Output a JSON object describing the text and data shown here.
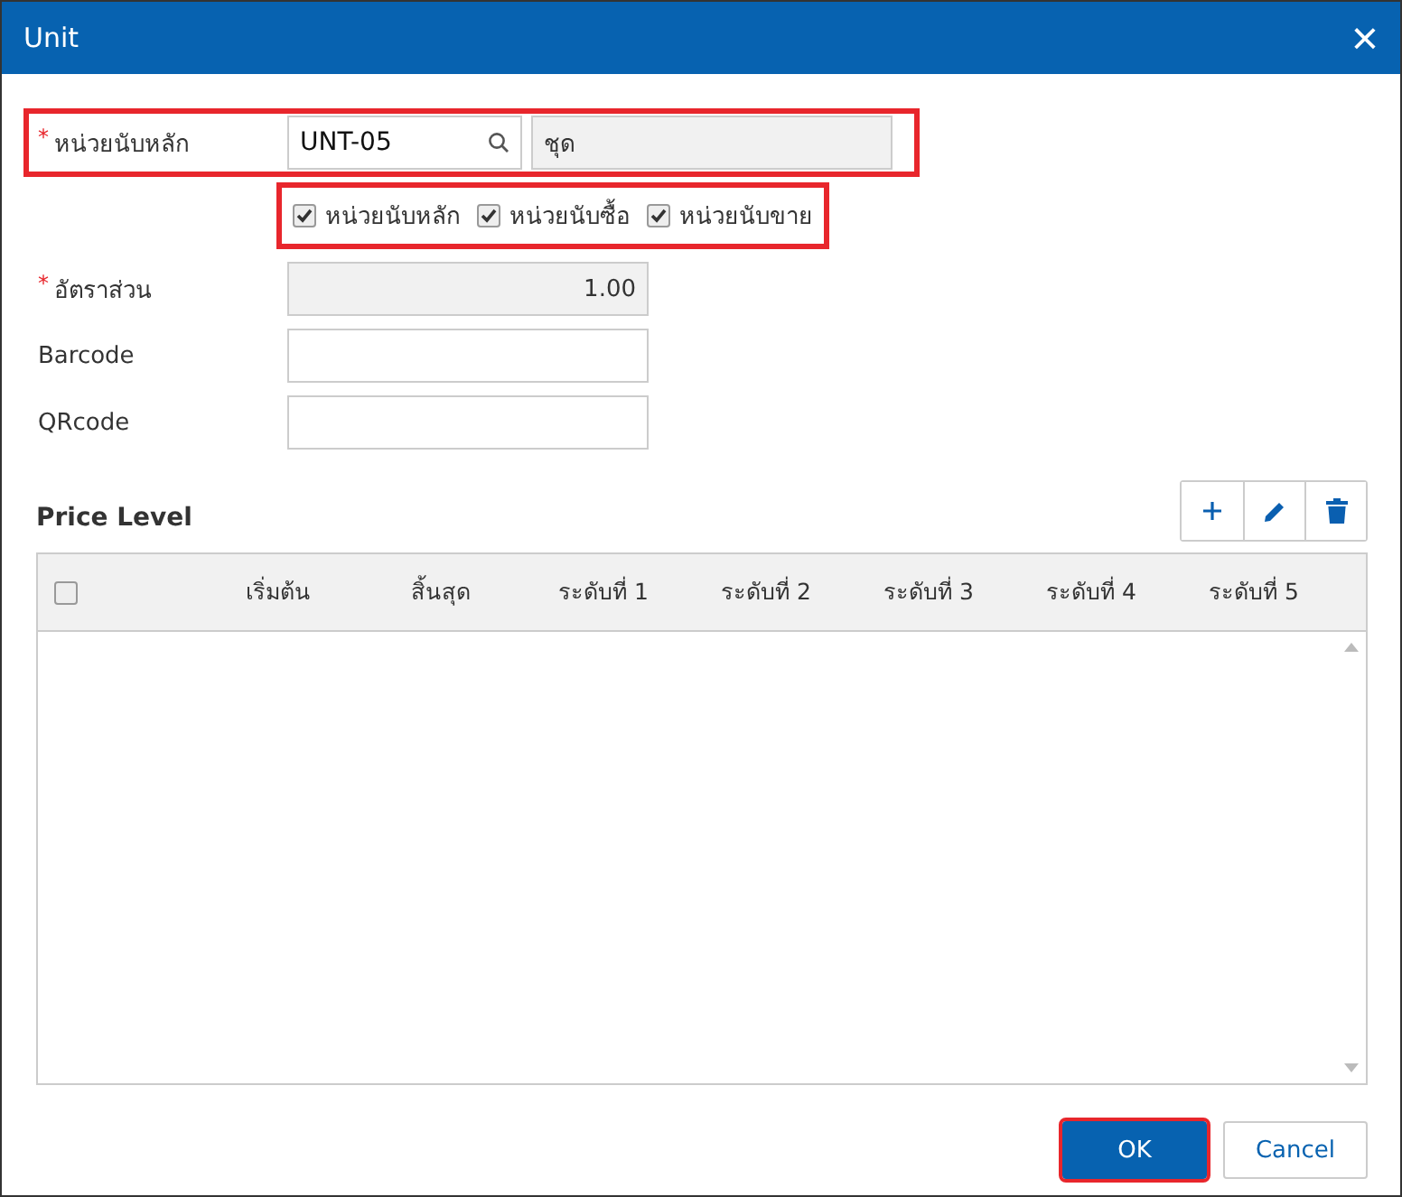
{
  "window": {
    "title": "Unit",
    "close": "×"
  },
  "main_unit": {
    "label": "หน่วยนับหลัก",
    "required_mark": "*",
    "value": "UNT-05",
    "name": "ชุด",
    "highlighted": true
  },
  "unit_flags": {
    "highlighted": true,
    "items": [
      {
        "label": "หน่วยนับหลัก",
        "checked": true
      },
      {
        "label": "หน่วยนับซื้อ",
        "checked": true
      },
      {
        "label": "หน่วยนับขาย",
        "checked": true
      }
    ]
  },
  "fields": [
    {
      "label": "อัตราส่วน",
      "required_mark": "*",
      "value": "1.00",
      "disabled": true
    },
    {
      "label": "Barcode",
      "disabled": false
    },
    {
      "label": "QRcode",
      "disabled": false
    }
  ],
  "price_level": {
    "title": "Price Level",
    "columns": [
      "เริ่มต้น",
      "สิ้นสุด",
      "ระดับที่ 1",
      "ระดับที่ 2",
      "ระดับที่ 3",
      "ระดับที่ 4",
      "ระดับที่ 5"
    ],
    "select_all_checked": false
  },
  "buttons": [
    {
      "label": "OK",
      "kind": "primary",
      "highlighted": true
    },
    {
      "label": "Cancel",
      "kind": "secondary",
      "highlighted": false
    }
  ]
}
